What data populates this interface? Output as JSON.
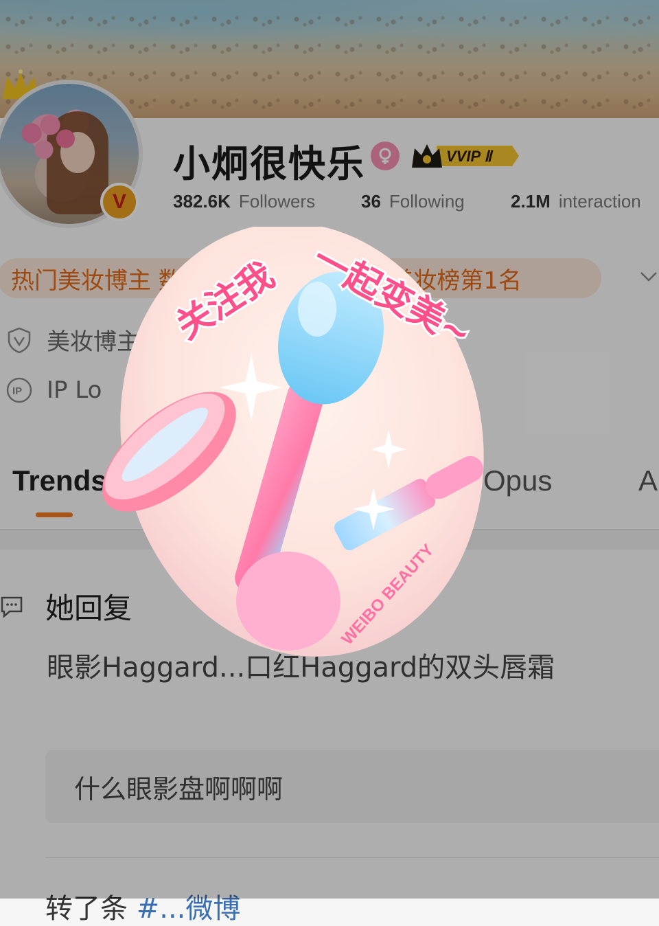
{
  "profile": {
    "username": "小炯很快乐",
    "vip_label": "VVIP Ⅱ",
    "verified_badge": "V",
    "stats": [
      {
        "value": "382.6K",
        "label": "Followers"
      },
      {
        "value": "36",
        "label": "Following"
      },
      {
        "value": "2.1M",
        "label": "interaction"
      }
    ],
    "tags": [
      "热门美妆博主 数据飙",
      "视频...美妆榜第1名"
    ],
    "category": "美妆博主",
    "ip_location": "IP Lo"
  },
  "tabs": [
    "Trends",
    "Opus",
    "A"
  ],
  "feed": {
    "post1_header": "她回复",
    "post1_body": "眼影Haggard...口红Haggard的双头唇霜",
    "post1_quote": "什么眼影盘啊啊啊",
    "post2_prefix": "转了条",
    "post2_link": "#...微博"
  },
  "popup": {
    "slogan_left": "关注我",
    "slogan_right": "一起变美~",
    "brand": "WEIBO BEAUTY"
  },
  "colors": {
    "accent": "#f07a20",
    "tag_text": "#e06a1a",
    "tag_bg": "#fbe5d8",
    "slogan": "#ff4f8b"
  }
}
